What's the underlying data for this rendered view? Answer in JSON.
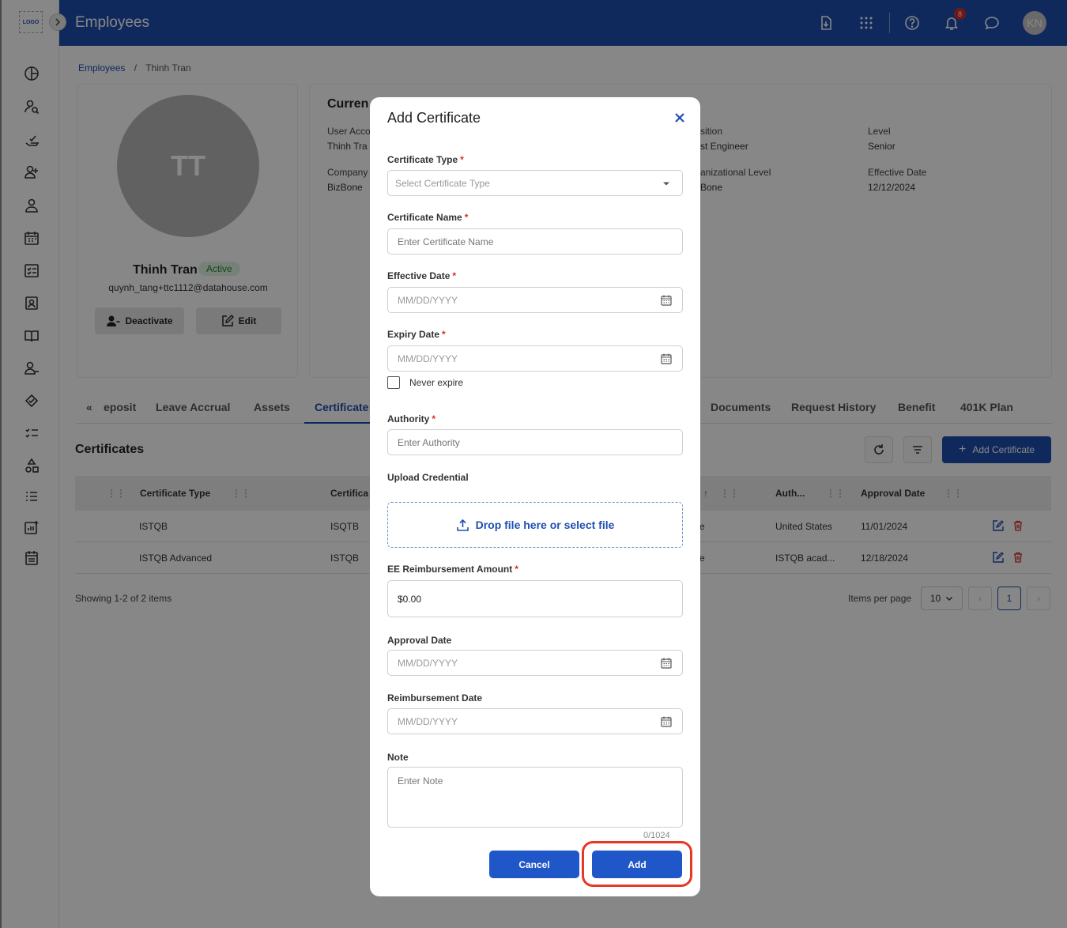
{
  "app": {
    "logo": "LOGO",
    "header_title": "Employees",
    "notification_count": "8",
    "user_initials": "KN"
  },
  "breadcrumb": {
    "parent": "Employees",
    "separator": "/",
    "current": "Thinh Tran"
  },
  "profile": {
    "initials": "TT",
    "name": "Thinh Tran",
    "status": "Active",
    "email": "quynh_tang+ttc1112@datahouse.com",
    "deactivate_label": "Deactivate",
    "edit_label": "Edit"
  },
  "current_info": {
    "title": "Curren",
    "user_account_label": "User Acco",
    "user_account_value": "Thinh Tra",
    "company_label": "Company",
    "company_value": "BizBone",
    "position_label": "sition",
    "position_value": "st Engineer",
    "org_level_label": "anizational Level",
    "org_level_value": "Bone",
    "level_label": "Level",
    "level_value": "Senior",
    "effective_date_label": "Effective Date",
    "effective_date_value": "12/12/2024"
  },
  "tabs": {
    "scroll_icon": "«",
    "items": [
      "eposit",
      "Leave Accrual",
      "Assets",
      "Certificate",
      "Documents",
      "Request History",
      "Benefit",
      "401K Plan"
    ]
  },
  "certificates": {
    "title": "Certificates",
    "add_label": "Add Certificate",
    "columns": [
      "Certificate Type",
      "Certifica",
      "Auth...",
      "Approval Date"
    ],
    "rows": [
      {
        "type": "ISTQB",
        "name": "ISQTB",
        "partial": "e",
        "authority": "United States",
        "approval": "11/01/2024"
      },
      {
        "type": "ISTQB Advanced",
        "name": "ISTQB",
        "partial": "e",
        "authority": "ISTQB acad...",
        "approval": "12/18/2024"
      }
    ],
    "showing": "Showing 1-2 of 2 items",
    "items_per_page_label": "Items per page",
    "items_per_page": "10",
    "current_page": "1"
  },
  "modal": {
    "title": "Add Certificate",
    "certificate_type_label": "Certificate Type",
    "certificate_type_placeholder": "Select Certificate Type",
    "certificate_name_label": "Certificate Name",
    "certificate_name_placeholder": "Enter Certificate Name",
    "effective_date_label": "Effective Date",
    "expiry_date_label": "Expiry Date",
    "date_placeholder": "MM/DD/YYYY",
    "never_expire_label": "Never expire",
    "authority_label": "Authority",
    "authority_placeholder": "Enter Authority",
    "upload_label": "Upload Credential",
    "upload_text": "Drop file here or select file",
    "reimbursement_amount_label": "EE Reimbursement Amount",
    "reimbursement_amount_value": "$0.00",
    "approval_date_label": "Approval Date",
    "reimbursement_date_label": "Reimbursement Date",
    "note_label": "Note",
    "note_placeholder": "Enter Note",
    "note_counter": "0/1024",
    "cancel_label": "Cancel",
    "add_label": "Add",
    "required_mark": "*"
  },
  "colors": {
    "primary": "#1f4fb0",
    "button": "#1f56c8",
    "required": "#d32f2f",
    "highlight": "#e53925",
    "delete": "#d32f2f"
  }
}
